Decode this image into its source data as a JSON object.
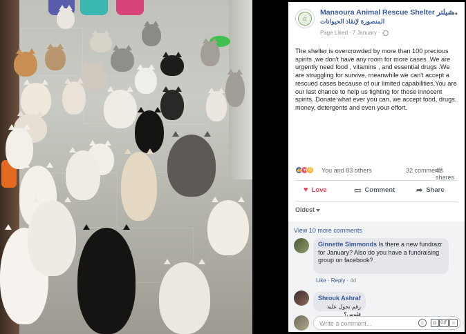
{
  "photo": {
    "alt_subject": "cats-in-shelter-room",
    "icon": "photo-icon"
  },
  "post": {
    "page_name": "Mansoura Animal Rescue Shelter شيلتر",
    "page_name_ar": "المنصورة لإنقاذ الحيوانات",
    "page_liked_label": "Page Liked",
    "date": "7 January",
    "body": "The shelter is overcrowded by more than 100 precious spirits ,we don't have any room for more cases .We are urgently need food , vitamins , and essential drugs .We are struggling for survive, meanwhile we can't accept a rescued cases because of our limited capabilities.You are our last chance to help us fighting for those innocent spirits. Donate what ever you can, we accept food, drugs, money, detergents and even your effort.",
    "reactions_text": "You and 83 others",
    "comments_count": "32 comments",
    "shares_count": "47 shares",
    "actions": {
      "love": "Love",
      "comment": "Comment",
      "share": "Share"
    },
    "sort_label": "Oldest",
    "view_more": "View 10 more comments",
    "comments": [
      {
        "author": "Ginnette Simmonds",
        "text": "Is there a new fundrazr for January? Also do you have a fundraising group on facebook?",
        "like": "Like",
        "reply": "Reply",
        "time": "4d"
      },
      {
        "author": "Shrouk Ashraf",
        "text": "رقم تحول عليه فلوس؟"
      }
    ],
    "write_placeholder": "Write a comment...",
    "colors": {
      "link": "#365899",
      "love": "#f33e58",
      "like": "#4267b2"
    }
  }
}
